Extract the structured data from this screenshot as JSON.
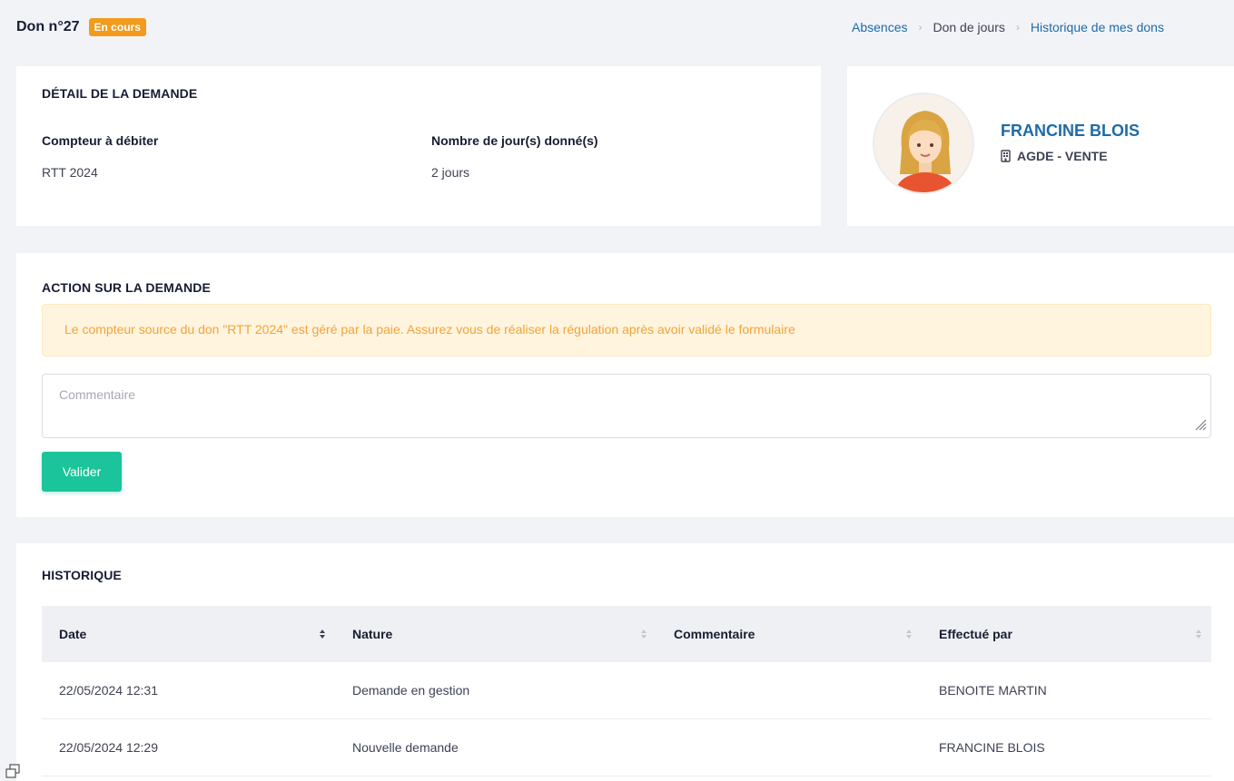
{
  "header": {
    "title": "Don n°27",
    "status_badge": "En cours",
    "breadcrumb": [
      "Absences",
      "Don de jours",
      "Historique de mes dons"
    ]
  },
  "detail": {
    "section_title": "DÉTAIL DE LA DEMANDE",
    "counter_label": "Compteur à débiter",
    "counter_value": "RTT 2024",
    "days_label": "Nombre de jour(s) donné(s)",
    "days_value": "2 jours"
  },
  "profile": {
    "name": "FRANCINE BLOIS",
    "site": "AGDE - VENTE",
    "site_icon": "building-icon"
  },
  "action": {
    "section_title": "ACTION SUR LA DEMANDE",
    "alert_text": "Le compteur source du don \"RTT 2024\" est géré par la paie. Assurez vous de réaliser la régulation après avoir validé le formulaire",
    "comment_placeholder": "Commentaire",
    "comment_value": "",
    "submit_label": "Valider"
  },
  "history": {
    "section_title": "HISTORIQUE",
    "columns": [
      "Date",
      "Nature",
      "Commentaire",
      "Effectué par"
    ],
    "rows": [
      {
        "date": "22/05/2024 12:31",
        "nature": "Demande en gestion",
        "comment": "",
        "by": "BENOITE MARTIN"
      },
      {
        "date": "22/05/2024 12:29",
        "nature": "Nouvelle demande",
        "comment": "",
        "by": "FRANCINE BLOIS"
      }
    ]
  },
  "colors": {
    "badge": "#f29b1d",
    "link": "#1e6ba8",
    "primary_button": "#1bc49a",
    "alert_bg": "#fff4de",
    "alert_text": "#f2a43a"
  }
}
